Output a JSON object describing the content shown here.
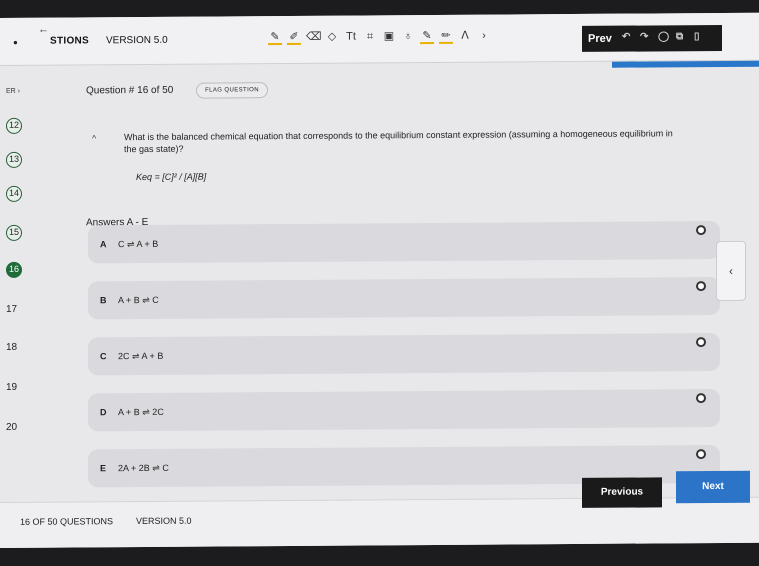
{
  "header": {
    "back_arrow": "←",
    "title": "STIONS",
    "version": "VERSION 5.0",
    "prev_label": "Prev",
    "tools": [
      {
        "icon": "pen-icon",
        "glyph": "✎"
      },
      {
        "icon": "highlighter-icon",
        "glyph": "✐"
      },
      {
        "icon": "eraser-icon",
        "glyph": "⌫"
      },
      {
        "icon": "shape-icon",
        "glyph": "◇"
      },
      {
        "icon": "text-tool-icon",
        "glyph": "Tt"
      },
      {
        "icon": "crop-icon",
        "glyph": "⌗"
      },
      {
        "icon": "image-icon",
        "glyph": "▣"
      },
      {
        "icon": "lightbulb-icon",
        "glyph": "♁"
      },
      {
        "icon": "marker-icon",
        "glyph": "✎"
      },
      {
        "icon": "pencil-icon",
        "glyph": "✏"
      },
      {
        "icon": "timer-icon",
        "glyph": "ⴷ"
      },
      {
        "icon": "forward-icon",
        "glyph": "›"
      }
    ]
  },
  "breadcrumb": "ER ›",
  "question_header": {
    "number": "Question # 16 of 50",
    "flag": "FLAG QUESTION"
  },
  "nav": [
    {
      "label": "12",
      "style": "circle"
    },
    {
      "label": "13",
      "style": "circle"
    },
    {
      "label": "14",
      "style": "circle"
    },
    {
      "label": "15",
      "style": "circle"
    },
    {
      "label": "16",
      "style": "active"
    },
    {
      "label": "17",
      "style": "plain"
    },
    {
      "label": "18",
      "style": "plain"
    },
    {
      "label": "19",
      "style": "plain"
    },
    {
      "label": "20",
      "style": "plain"
    }
  ],
  "question": {
    "text": "What is the balanced chemical equation that corresponds to the equilibrium constant expression (assuming a homogeneous equilibrium in the gas state)?",
    "formula": "Keq = [C]² / [A][B]",
    "answers": "Answers A - E"
  },
  "options": [
    {
      "letter": "A",
      "text": "C ⇌ A + B"
    },
    {
      "letter": "B",
      "text": "A + B ⇌ C"
    },
    {
      "letter": "C",
      "text": "2C ⇌ A + B"
    },
    {
      "letter": "D",
      "text": "A + B ⇌ 2C"
    },
    {
      "letter": "E",
      "text": "2A + 2B ⇌ C"
    }
  ],
  "side_tab": "‹",
  "footer": {
    "count": "16 OF 50 QUESTIONS",
    "version": "VERSION 5.0",
    "previous": "Previous",
    "next": "Next"
  },
  "colors": {
    "accent": "#2b74c8",
    "active_nav": "#1f6b3a",
    "dark_button": "#1a1a1a"
  }
}
